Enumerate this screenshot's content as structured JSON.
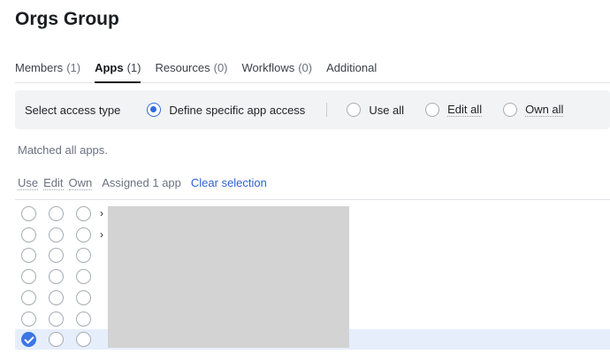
{
  "page": {
    "title": "Orgs Group"
  },
  "tabs": [
    {
      "label": "Members",
      "count": "(1)",
      "active": false
    },
    {
      "label": "Apps",
      "count": "(1)",
      "active": true
    },
    {
      "label": "Resources",
      "count": "(0)",
      "active": false
    },
    {
      "label": "Workflows",
      "count": "(0)",
      "active": false
    },
    {
      "label": "Additional",
      "count": "",
      "active": false
    }
  ],
  "access": {
    "label": "Select access type",
    "options": [
      {
        "label": "Define specific app access",
        "selected": true
      },
      {
        "label": "Use all",
        "selected": false
      },
      {
        "label": "Edit all",
        "selected": false
      },
      {
        "label": "Own all",
        "selected": false
      }
    ]
  },
  "status": {
    "matched": "Matched all apps."
  },
  "list_header": {
    "use": "Use",
    "edit": "Edit",
    "own": "Own",
    "assigned": "Assigned 1 app",
    "clear": "Clear selection"
  },
  "rows": [
    {
      "expandable": true,
      "use": false,
      "edit": false,
      "own": false
    },
    {
      "expandable": true,
      "use": false,
      "edit": false,
      "own": false
    },
    {
      "expandable": false,
      "use": false,
      "edit": false,
      "own": false
    },
    {
      "expandable": false,
      "use": false,
      "edit": false,
      "own": false
    },
    {
      "expandable": false,
      "use": false,
      "edit": false,
      "own": false
    },
    {
      "expandable": false,
      "use": false,
      "edit": false,
      "own": false
    },
    {
      "expandable": false,
      "use": true,
      "edit": false,
      "own": false
    }
  ],
  "icons": {
    "expand": "chevron-right-icon",
    "expand_glyph": "›"
  },
  "colors": {
    "accent": "#2f6ae0",
    "selected_row": "#e6eefc",
    "redacted": "#d3d3d3"
  }
}
